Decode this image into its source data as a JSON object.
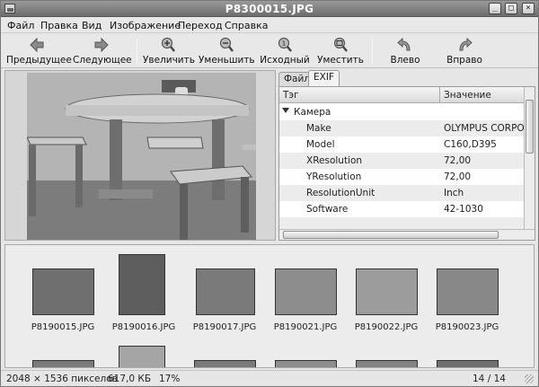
{
  "window": {
    "title": "P8300015.JPG"
  },
  "menu": [
    {
      "label": "Файл"
    },
    {
      "label": "Правка"
    },
    {
      "label": "Вид"
    },
    {
      "label": "Изображение"
    },
    {
      "label": "Переход"
    },
    {
      "label": "Справка"
    }
  ],
  "toolbar": [
    {
      "label": "Предыдущее",
      "icon": "arrow-left-icon"
    },
    {
      "label": "Следующее",
      "icon": "arrow-right-icon"
    },
    {
      "label": "Увеличить",
      "icon": "zoom-in-icon"
    },
    {
      "label": "Уменьшить",
      "icon": "zoom-out-icon"
    },
    {
      "label": "Исходный",
      "icon": "zoom-original-icon"
    },
    {
      "label": "Уместить",
      "icon": "zoom-fit-icon"
    },
    {
      "label": "Влево",
      "icon": "rotate-left-icon"
    },
    {
      "label": "Вправо",
      "icon": "rotate-right-icon"
    }
  ],
  "sidebar": {
    "tabs": [
      {
        "label": "Файл"
      },
      {
        "label": "EXIF"
      }
    ],
    "active_tab": "EXIF",
    "columns": {
      "tag": "Тэг",
      "value": "Значение"
    },
    "group": "Камера",
    "rows": [
      {
        "tag": "Make",
        "value": "OLYMPUS CORPORA"
      },
      {
        "tag": "Model",
        "value": "C160,D395"
      },
      {
        "tag": "XResolution",
        "value": "72,00"
      },
      {
        "tag": "YResolution",
        "value": "72,00"
      },
      {
        "tag": "ResolutionUnit",
        "value": "Inch"
      },
      {
        "tag": "Software",
        "value": "42-1030"
      }
    ]
  },
  "thumbnails": [
    {
      "name": "P8190015.JPG"
    },
    {
      "name": "P8190016.JPG"
    },
    {
      "name": "P8190017.JPG"
    },
    {
      "name": "P8190021.JPG"
    },
    {
      "name": "P8190022.JPG"
    },
    {
      "name": "P8190023.JPG"
    }
  ],
  "status": {
    "dimensions": "2048 × 1536 пикселов",
    "filesize": "617,0 КБ",
    "zoom": "17%",
    "position": "14 / 14"
  },
  "colors": {
    "titlebar": "#7f7f7f",
    "panel": "#e6e6e6",
    "selection": "#ececec"
  }
}
